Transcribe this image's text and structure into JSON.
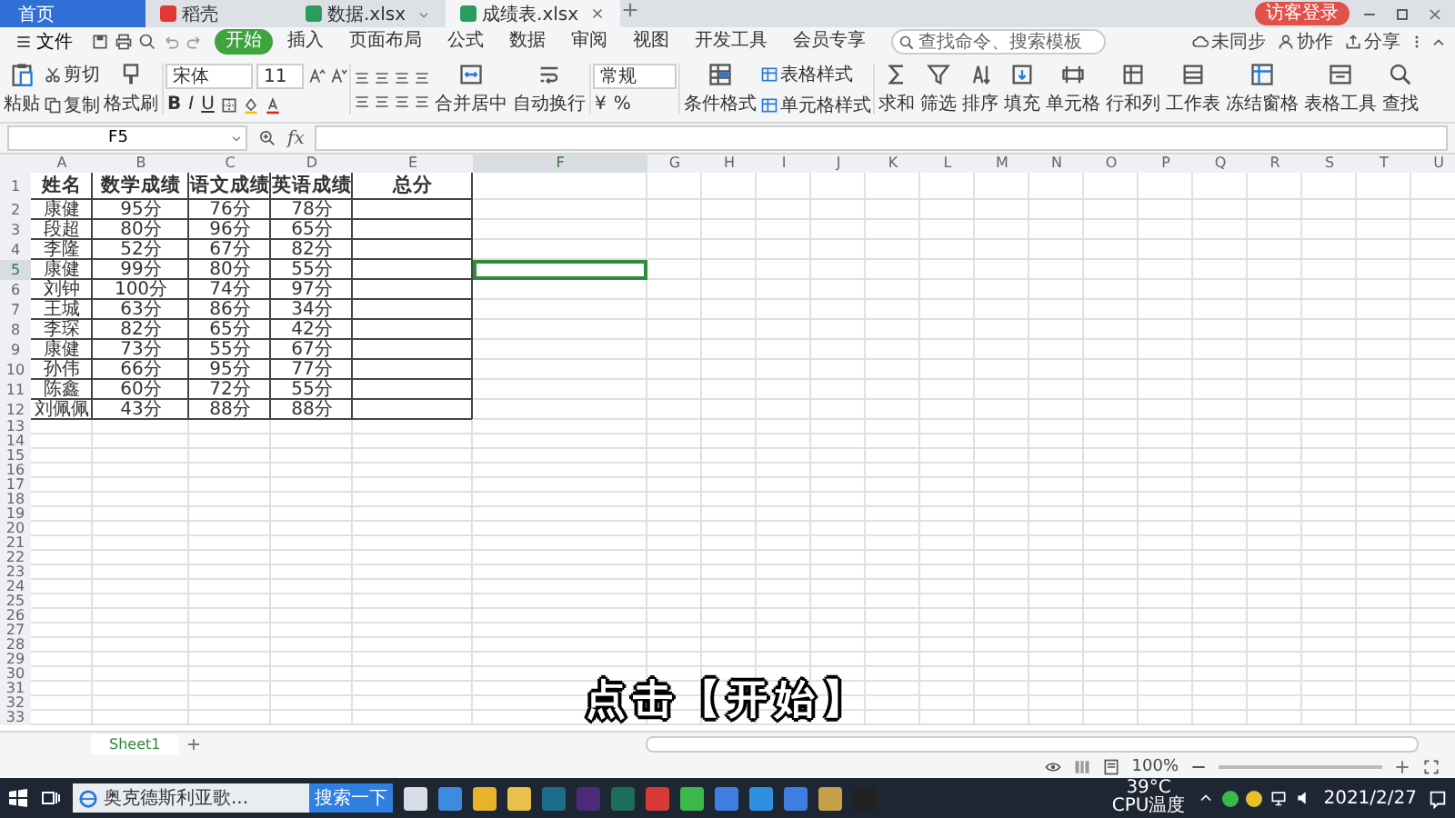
{
  "tabs": [
    {
      "label": "首页",
      "kind": "home",
      "selected": false
    },
    {
      "label": "稻壳",
      "kind": "docer",
      "selected": false
    },
    {
      "label": "数据.xlsx",
      "kind": "sheet",
      "selected": false
    },
    {
      "label": "成绩表.xlsx",
      "kind": "sheet",
      "selected": true
    }
  ],
  "login_button": "访客登录",
  "menu": {
    "file": "文件",
    "items": [
      {
        "label": "开始",
        "selected": true
      },
      {
        "label": "插入",
        "selected": false
      },
      {
        "label": "页面布局",
        "selected": false
      },
      {
        "label": "公式",
        "selected": false
      },
      {
        "label": "数据",
        "selected": false
      },
      {
        "label": "审阅",
        "selected": false
      },
      {
        "label": "视图",
        "selected": false
      },
      {
        "label": "开发工具",
        "selected": false
      },
      {
        "label": "会员专享",
        "selected": false
      }
    ],
    "search": {
      "placeholder": "查找命令、搜索模板"
    },
    "links": [
      {
        "label": "未同步",
        "kind": "sync"
      },
      {
        "label": "协作",
        "kind": "collab"
      },
      {
        "label": "分享",
        "kind": "share"
      }
    ]
  },
  "ribbon": {
    "paste": "粘贴",
    "cut": "剪切",
    "copy": "复制",
    "format_painter": "格式刷",
    "font": {
      "name": "宋体",
      "size": "11",
      "bold": "B",
      "italic": "I",
      "underline": "U"
    },
    "merge": "合并居中",
    "wrap": "自动换行",
    "number": {
      "format": "常规",
      "symbols": [
        "¥",
        "%"
      ]
    },
    "conditional": "条件格式",
    "table_style": "表格样式",
    "cell_style": "单元格样式",
    "tools": [
      {
        "label": "求和",
        "kind": "sum"
      },
      {
        "label": "筛选",
        "kind": "filter"
      },
      {
        "label": "排序",
        "kind": "sort"
      },
      {
        "label": "填充",
        "kind": "fill"
      },
      {
        "label": "单元格",
        "kind": "cell"
      },
      {
        "label": "行和列",
        "kind": "rows"
      },
      {
        "label": "工作表",
        "kind": "sheet"
      },
      {
        "label": "冻结窗格",
        "kind": "freeze"
      },
      {
        "label": "表格工具",
        "kind": "tools"
      },
      {
        "label": "查找",
        "kind": "find"
      }
    ]
  },
  "formula_bar": {
    "name_box": "F5",
    "fx": "fx"
  },
  "sheet": {
    "columns": [
      {
        "label": "A",
        "selected": false
      },
      {
        "label": "B",
        "selected": false
      },
      {
        "label": "C",
        "selected": false
      },
      {
        "label": "D",
        "selected": false
      },
      {
        "label": "E",
        "selected": false
      },
      {
        "label": "F",
        "selected": true
      },
      {
        "label": "G",
        "selected": false
      },
      {
        "label": "H",
        "selected": false
      },
      {
        "label": "I",
        "selected": false
      },
      {
        "label": "J",
        "selected": false
      },
      {
        "label": "K",
        "selected": false
      },
      {
        "label": "L",
        "selected": false
      },
      {
        "label": "M",
        "selected": false
      },
      {
        "label": "N",
        "selected": false
      },
      {
        "label": "O",
        "selected": false
      },
      {
        "label": "P",
        "selected": false
      },
      {
        "label": "Q",
        "selected": false
      },
      {
        "label": "R",
        "selected": false
      },
      {
        "label": "S",
        "selected": false
      },
      {
        "label": "T",
        "selected": false
      },
      {
        "label": "U",
        "selected": false
      }
    ],
    "row_numbers": [
      {
        "label": "1",
        "selected": false
      },
      {
        "label": "2",
        "selected": false
      },
      {
        "label": "3",
        "selected": false
      },
      {
        "label": "4",
        "selected": false
      },
      {
        "label": "5",
        "selected": true
      },
      {
        "label": "6",
        "selected": false
      },
      {
        "label": "7",
        "selected": false
      },
      {
        "label": "8",
        "selected": false
      },
      {
        "label": "9",
        "selected": false
      },
      {
        "label": "10",
        "selected": false
      },
      {
        "label": "11",
        "selected": false
      },
      {
        "label": "12",
        "selected": false
      },
      {
        "label": "13",
        "selected": false
      },
      {
        "label": "14",
        "selected": false
      },
      {
        "label": "15",
        "selected": false
      },
      {
        "label": "16",
        "selected": false
      },
      {
        "label": "17",
        "selected": false
      },
      {
        "label": "18",
        "selected": false
      },
      {
        "label": "19",
        "selected": false
      },
      {
        "label": "20",
        "selected": false
      },
      {
        "label": "21",
        "selected": false
      },
      {
        "label": "22",
        "selected": false
      },
      {
        "label": "23",
        "selected": false
      },
      {
        "label": "24",
        "selected": false
      },
      {
        "label": "25",
        "selected": false
      },
      {
        "label": "26",
        "selected": false
      },
      {
        "label": "27",
        "selected": false
      },
      {
        "label": "28",
        "selected": false
      },
      {
        "label": "29",
        "selected": false
      },
      {
        "label": "30",
        "selected": false
      },
      {
        "label": "31",
        "selected": false
      },
      {
        "label": "32",
        "selected": false
      },
      {
        "label": "33",
        "selected": false
      }
    ],
    "rows": [
      [
        "姓名",
        "数学成绩",
        "语文成绩",
        "英语成绩",
        "总分"
      ],
      [
        "康健",
        "95分",
        "76分",
        "78分",
        ""
      ],
      [
        "段超",
        "80分",
        "96分",
        "65分",
        ""
      ],
      [
        "李隆",
        "52分",
        "67分",
        "82分",
        ""
      ],
      [
        "康健",
        "99分",
        "80分",
        "55分",
        ""
      ],
      [
        "刘钟",
        "100分",
        "74分",
        "97分",
        ""
      ],
      [
        "王城",
        "63分",
        "86分",
        "34分",
        ""
      ],
      [
        "李琛",
        "82分",
        "65分",
        "42分",
        ""
      ],
      [
        "康健",
        "73分",
        "55分",
        "67分",
        ""
      ],
      [
        "孙伟",
        "66分",
        "95分",
        "77分",
        ""
      ],
      [
        "陈鑫",
        "60分",
        "72分",
        "55分",
        ""
      ],
      [
        "刘佩佩",
        "43分",
        "88分",
        "88分",
        ""
      ]
    ]
  },
  "caption": "点击【开始】",
  "sheet_tabs": [
    {
      "label": "Sheet1",
      "selected": true
    }
  ],
  "status_bar": {
    "zoom": "100%"
  },
  "taskbar": {
    "search_text": "奥克德斯利亚歌...",
    "search_button": "搜索一下",
    "temperature": "39°C",
    "temperature_label": "CPU温度",
    "date": "2021/2/27"
  }
}
